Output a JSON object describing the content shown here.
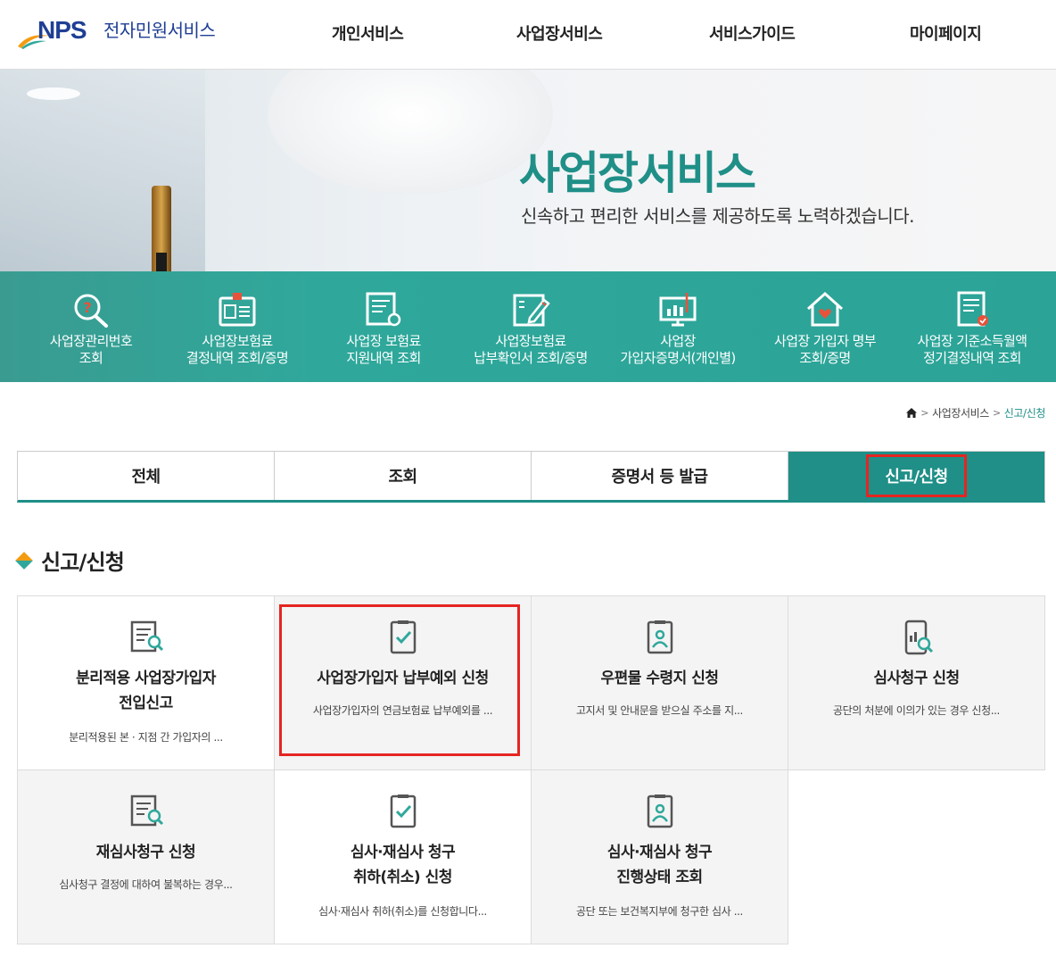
{
  "logo": {
    "brand": "NPS",
    "service": "전자민원서비스"
  },
  "nav": [
    "개인서비스",
    "사업장서비스",
    "서비스가이드",
    "마이페이지"
  ],
  "hero": {
    "title": "사업장서비스",
    "subtitle": "신속하고 편리한 서비스를 제공하도록 노력하겠습니다."
  },
  "quick_menu": [
    {
      "label": "사업장관리번호\n조회",
      "icon": "search-question-icon"
    },
    {
      "label": "사업장보험료\n결정내역 조회/증명",
      "icon": "id-card-icon"
    },
    {
      "label": "사업장 보험료\n지원내역 조회",
      "icon": "document-search-icon"
    },
    {
      "label": "사업장보험료\n납부확인서 조회/증명",
      "icon": "document-pen-icon"
    },
    {
      "label": "사업장\n가입자증명서(개인별)",
      "icon": "monitor-chart-icon"
    },
    {
      "label": "사업장 가입자 명부\n조회/증명",
      "icon": "house-heart-icon"
    },
    {
      "label": "사업장 기준소득월액\n정기결정내역 조회",
      "icon": "document-check-icon"
    }
  ],
  "breadcrumb": {
    "level1": "사업장서비스",
    "current": "신고/신청"
  },
  "tabs": [
    "전체",
    "조회",
    "증명서 등 발급",
    "신고/신청"
  ],
  "section_title": "신고/신청",
  "cards": [
    {
      "title": "분리적용 사업장가입자\n전입신고",
      "desc": "분리적용된 본 · 지점 간 가입자의 ...",
      "icon": "document-search-icon"
    },
    {
      "title": "사업장가입자 납부예외 신청",
      "desc": "사업장가입자의 연금보험료 납부예외를 ...",
      "icon": "clipboard-check-icon"
    },
    {
      "title": "우편물 수령지 신청",
      "desc": "고지서 및 안내문을 받으실 주소를 지...",
      "icon": "person-badge-icon"
    },
    {
      "title": "심사청구 신청",
      "desc": "공단의 처분에 이의가 있는 경우 신청...",
      "icon": "mobile-search-icon"
    },
    {
      "title": "재심사청구 신청",
      "desc": "심사청구 결정에 대하여 불복하는 경우...",
      "icon": "document-search-icon"
    },
    {
      "title": "심사·재심사 청구\n취하(취소) 신청",
      "desc": "심사·재심사 취하(취소)를 신청합니다...",
      "icon": "clipboard-check-icon"
    },
    {
      "title": "심사·재심사 청구\n진행상태 조회",
      "desc": "공단 또는 보건복지부에 청구한 심사 ...",
      "icon": "person-badge-icon"
    }
  ],
  "colors": {
    "brand_teal": "#1f8f87",
    "quick_bg": "#2fa89b",
    "logo_blue": "#1f3f94",
    "highlight_red": "#e52521"
  }
}
